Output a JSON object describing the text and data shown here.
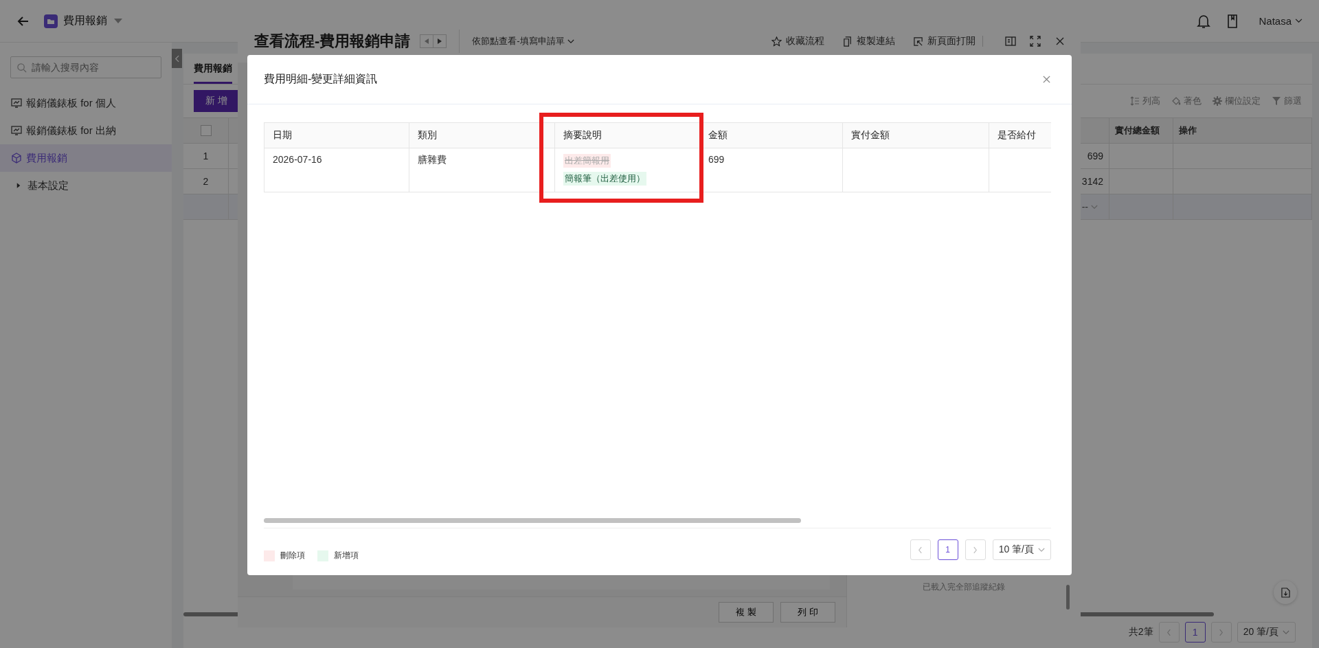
{
  "top_bar": {
    "app_title": "費用報銷",
    "user": "Natasa"
  },
  "sidebar": {
    "search": {
      "placeholder": "請輸入搜尋內容"
    },
    "items": [
      {
        "label": "報銷儀錶板 for 個人",
        "kind": "dashboard",
        "selected": false
      },
      {
        "label": "報銷儀錶板 for 出納",
        "kind": "dashboard",
        "selected": false
      },
      {
        "label": "費用報銷",
        "kind": "form",
        "selected": true
      },
      {
        "label": "基本設定",
        "kind": "group",
        "expanded": false
      }
    ]
  },
  "main": {
    "tabs": [
      {
        "label": "費用報銷",
        "selected": true
      }
    ],
    "add_button": "新 增",
    "tools": [
      {
        "label": "列高",
        "kind": "height"
      },
      {
        "label": "著色",
        "kind": "color"
      },
      {
        "label": "欄位設定",
        "kind": "gear"
      },
      {
        "label": "篩選",
        "kind": "filter"
      }
    ],
    "select_all": {
      "checked": false
    },
    "columns": [
      "實付總金額",
      "操作"
    ],
    "rows": [
      {
        "index": "1",
        "amount": "699"
      },
      {
        "index": "2",
        "amount": "3142"
      }
    ],
    "summary_select": "--",
    "pager": {
      "total": "共2筆",
      "pages": [
        {
          "label": "1",
          "selected": true
        }
      ],
      "page_size": "20 筆/頁"
    }
  },
  "flow_window": {
    "title": "查看流程-費用報銷申請",
    "node_select": "依節點查看-填寫申請單",
    "actions": [
      {
        "label": "收藏流程",
        "kind": "star"
      },
      {
        "label": "複製連結",
        "kind": "copy"
      },
      {
        "label": "新頁面打開",
        "kind": "open"
      }
    ],
    "footer_buttons": [
      "複 製",
      "列 印"
    ],
    "trace_status": "已載入完全部追蹤紀錄"
  },
  "modal": {
    "title": "費用明細-變更詳細資訊",
    "columns": [
      "日期",
      "類別",
      "摘要說明",
      "金額",
      "實付金額",
      "是否給付"
    ],
    "rows": [
      {
        "cells": [
          {
            "kind": "text",
            "text": "2026-07-16"
          },
          {
            "kind": "text",
            "text": "膳雜費"
          },
          {
            "kind": "diff",
            "deleted": "出差簡報用",
            "added": "簡報筆（出差使用）",
            "highlighted": true
          },
          {
            "kind": "text",
            "text": "699"
          },
          {
            "kind": "empty"
          },
          {
            "kind": "empty"
          }
        ]
      }
    ],
    "legend": [
      {
        "label": "刪除項",
        "color": "#fdeaea"
      },
      {
        "label": "新增項",
        "color": "#e6f8ee"
      }
    ],
    "pager": {
      "pages": [
        {
          "label": "1",
          "selected": true
        }
      ],
      "page_size": "10 筆/頁"
    }
  }
}
